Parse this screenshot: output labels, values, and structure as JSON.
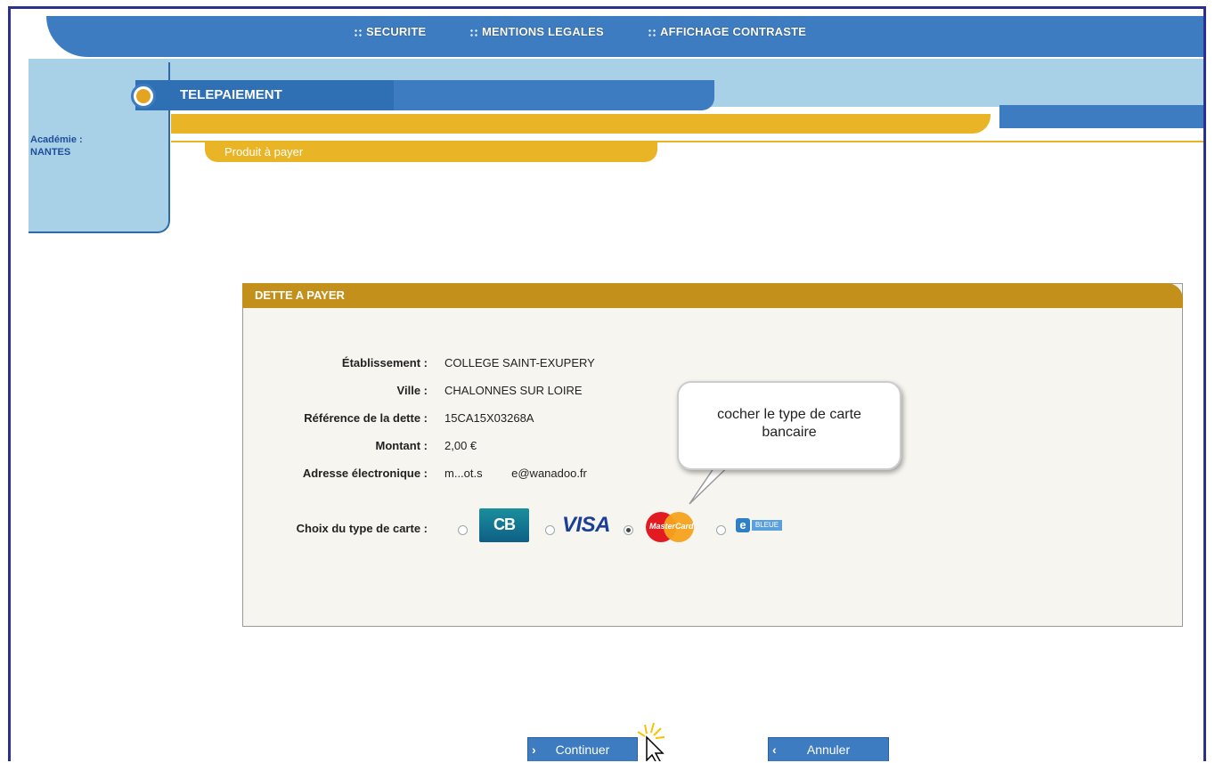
{
  "nav": {
    "securite": "SECURITE",
    "mentions": "MENTIONS LEGALES",
    "contraste": "AFFICHAGE CONTRASTE"
  },
  "header": {
    "title": "TELEPAIEMENT",
    "academie_label": "Académie :",
    "academie_value": "NANTES",
    "step": "Produit à payer"
  },
  "panel": {
    "title": "DETTE A PAYER",
    "rows": [
      {
        "label": "Établissement :",
        "value": "COLLEGE SAINT-EXUPERY"
      },
      {
        "label": "Ville :",
        "value": "CHALONNES SUR LOIRE"
      },
      {
        "label": "Référence de la dette :",
        "value": "15CA15X03268A"
      },
      {
        "label": "Montant :",
        "value": "2,00 €"
      },
      {
        "label": "Adresse électronique :",
        "value": "m...ot.s         e@wanadoo.fr"
      }
    ],
    "card_choice_label": "Choix du type de carte :",
    "cards": [
      {
        "name": "CB",
        "logo_text": "CB",
        "selected": false
      },
      {
        "name": "VISA",
        "logo_text": "VISA",
        "selected": false
      },
      {
        "name": "MasterCard",
        "logo_text": "MasterCard",
        "selected": true
      },
      {
        "name": "e-carte bleue",
        "logo_text_e": "e",
        "logo_text_b": "BLEUE",
        "selected": false
      }
    ]
  },
  "callout": {
    "line1": "cocher le type de carte",
    "line2": "bancaire"
  },
  "buttons": {
    "continue": "Continuer",
    "cancel": "Annuler"
  },
  "colors": {
    "accent_blue": "#3d7cc0",
    "light_blue": "#a8d0e6",
    "gold": "#e9b425",
    "panel_header": "#c4901c"
  }
}
